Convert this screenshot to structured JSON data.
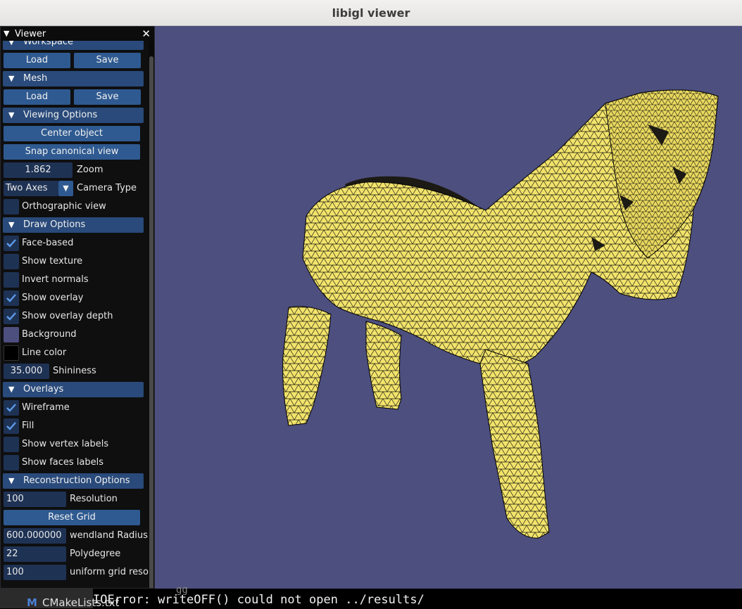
{
  "window": {
    "title": "libigl viewer"
  },
  "colors": {
    "background": "#4d4f7e",
    "mesh_fill": "#f2e36b",
    "wireframe": "#000000",
    "section_header": "#294a7a",
    "button": "#2f5a91"
  },
  "panel": {
    "title": "Viewer",
    "close": "✕",
    "sections": {
      "workspace": {
        "title": "Workspace",
        "load": "Load",
        "save": "Save"
      },
      "mesh": {
        "title": "Mesh",
        "load": "Load",
        "save": "Save"
      },
      "viewing": {
        "title": "Viewing Options",
        "center_object": "Center object",
        "snap_canonical": "Snap canonical view",
        "zoom_value": "1.862",
        "zoom_label": "Zoom",
        "camera_type_value": "Two Axes",
        "camera_type_label": "Camera Type",
        "orthographic_label": "Orthographic view",
        "orthographic_checked": false
      },
      "draw": {
        "title": "Draw Options",
        "items": [
          {
            "label": "Face-based",
            "checked": true
          },
          {
            "label": "Show texture",
            "checked": false
          },
          {
            "label": "Invert normals",
            "checked": false
          },
          {
            "label": "Show overlay",
            "checked": true
          },
          {
            "label": "Show overlay depth",
            "checked": true
          }
        ],
        "background_label": "Background",
        "background_color": "#4d4f7e",
        "line_color_label": "Line color",
        "line_color": "#000000",
        "shininess_value": "35.000",
        "shininess_label": "Shininess"
      },
      "overlays": {
        "title": "Overlays",
        "items": [
          {
            "label": "Wireframe",
            "checked": true
          },
          {
            "label": "Fill",
            "checked": true
          },
          {
            "label": "Show vertex labels",
            "checked": false
          },
          {
            "label": "Show faces labels",
            "checked": false
          }
        ]
      },
      "reconstruction": {
        "title": "Reconstruction Options",
        "resolution_value": "100",
        "resolution_label": "Resolution",
        "reset_grid": "Reset Grid",
        "wendland_value": "600.000000",
        "wendland_label": "wendland Radius",
        "polydegree_value": "22",
        "polydegree_label": "Polydegree",
        "uniform_value": "100",
        "uniform_label": "uniform grid resolution"
      }
    }
  },
  "taskbar": {
    "icon": "M",
    "label": "CMakeLists.txt"
  },
  "terminal": {
    "line": "IOError: writeOFF() could not open ../results/",
    "above_fragment": "gg"
  }
}
